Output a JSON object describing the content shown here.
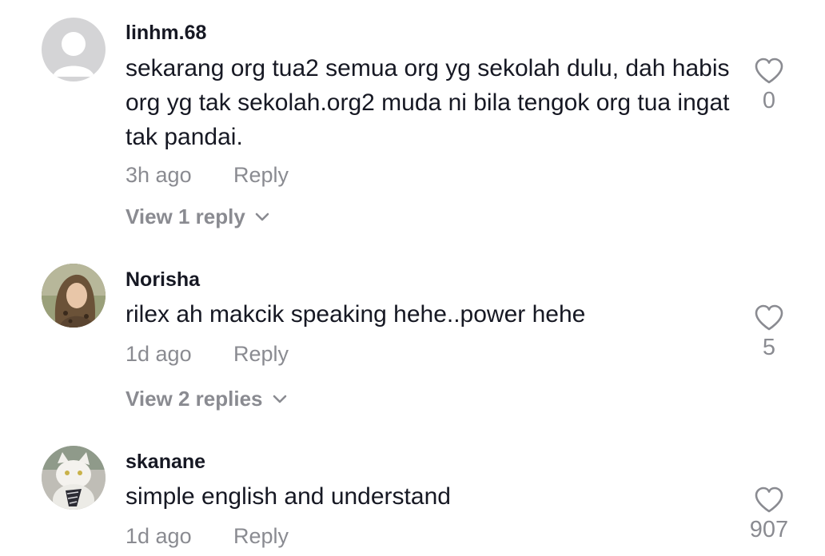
{
  "comments": [
    {
      "username": "linhm.68",
      "text": "sekarang org tua2 semua org yg sekolah dulu, dah habis org yg tak sekolah.org2 muda ni bila tengok org tua ingat tak pandai.",
      "time": "3h ago",
      "reply_label": "Reply",
      "likes": "0",
      "view_replies": "View 1 reply",
      "avatar": "default-avatar-icon"
    },
    {
      "username": "Norisha",
      "text": "rilex ah makcik speaking hehe..power hehe",
      "time": "1d ago",
      "reply_label": "Reply",
      "likes": "5",
      "view_replies": "View 2 replies",
      "avatar": "user-photo-avatar"
    },
    {
      "username": "skanane",
      "text": "simple english and understand",
      "time": "1d ago",
      "reply_label": "Reply",
      "likes": "907",
      "avatar": "cat-photo-avatar"
    }
  ],
  "colors": {
    "text_primary": "#161823",
    "text_secondary": "#8a8b91",
    "default_avatar_bg": "#d4d4d6"
  }
}
